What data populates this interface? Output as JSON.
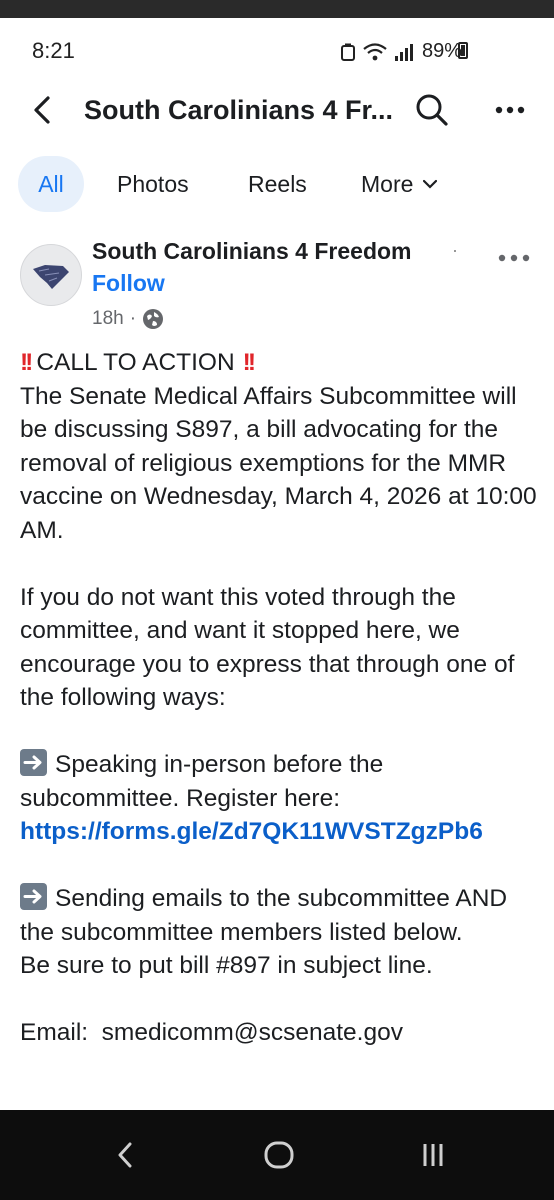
{
  "status_bar": {
    "time": "8:21",
    "battery": "89%"
  },
  "app_bar": {
    "title": "South Carolinians 4 Fr..."
  },
  "tabs": [
    {
      "label": "All",
      "active": true
    },
    {
      "label": "Photos"
    },
    {
      "label": "Reels"
    },
    {
      "label": "More"
    }
  ],
  "post": {
    "author": "South Carolinians 4 Freedom",
    "follow_label": "Follow",
    "time_ago": "18h",
    "headline": "CALL TO ACTION",
    "paragraph1": "The Senate Medical Affairs Subcommittee will be discussing S897, a bill advocating for the removal of religious exemptions for the MMR vaccine on Wednesday, March 4, 2026 at 10:00 AM.",
    "paragraph2": "If you do not want this voted through the committee, and want it stopped here, we encourage you to express that through one of the following ways:",
    "option1": "Speaking in-person before the subcommittee. Register here:",
    "option1_link": "https://forms.gle/Zd7QK11WVSTZgzPb6",
    "option2": "Sending emails to the subcommittee AND the subcommittee members listed below.",
    "option2_note": "Be sure to put bill #897 in subject line.",
    "email_line": "Email:  smedicomm@scsenate.gov"
  },
  "colors": {
    "accent": "#1877f2",
    "link": "#0b5fc9",
    "emoji_red": "#e0252a"
  }
}
